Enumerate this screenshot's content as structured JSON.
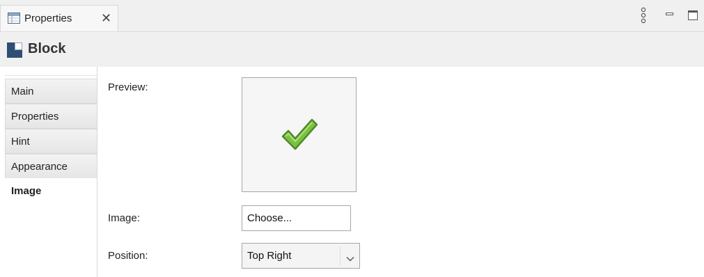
{
  "view": {
    "tab_label": "Properties",
    "close_glyph": "✕",
    "title": "Block"
  },
  "side_tabs": [
    {
      "label": "Main",
      "active": false
    },
    {
      "label": "Properties",
      "active": false
    },
    {
      "label": "Hint",
      "active": false
    },
    {
      "label": "Appearance",
      "active": false
    },
    {
      "label": "Image",
      "active": true
    }
  ],
  "image_page": {
    "preview_label": "Preview:",
    "image_label": "Image:",
    "choose_button": "Choose...",
    "position_label": "Position:",
    "position_value": "Top Right"
  },
  "icons": {
    "tab": "properties-table-icon",
    "close": "close-icon",
    "view_menu": "view-menu-icon",
    "minimize": "minimize-icon",
    "maximize": "maximize-icon",
    "block": "block-icon",
    "preview_image": "checkmark-icon",
    "dropdown": "chevron-down-icon"
  },
  "colors": {
    "checkmark": "#7bc142",
    "checkmark_outline": "#4f8a2a",
    "panel_bg": "#f0f0f0"
  }
}
